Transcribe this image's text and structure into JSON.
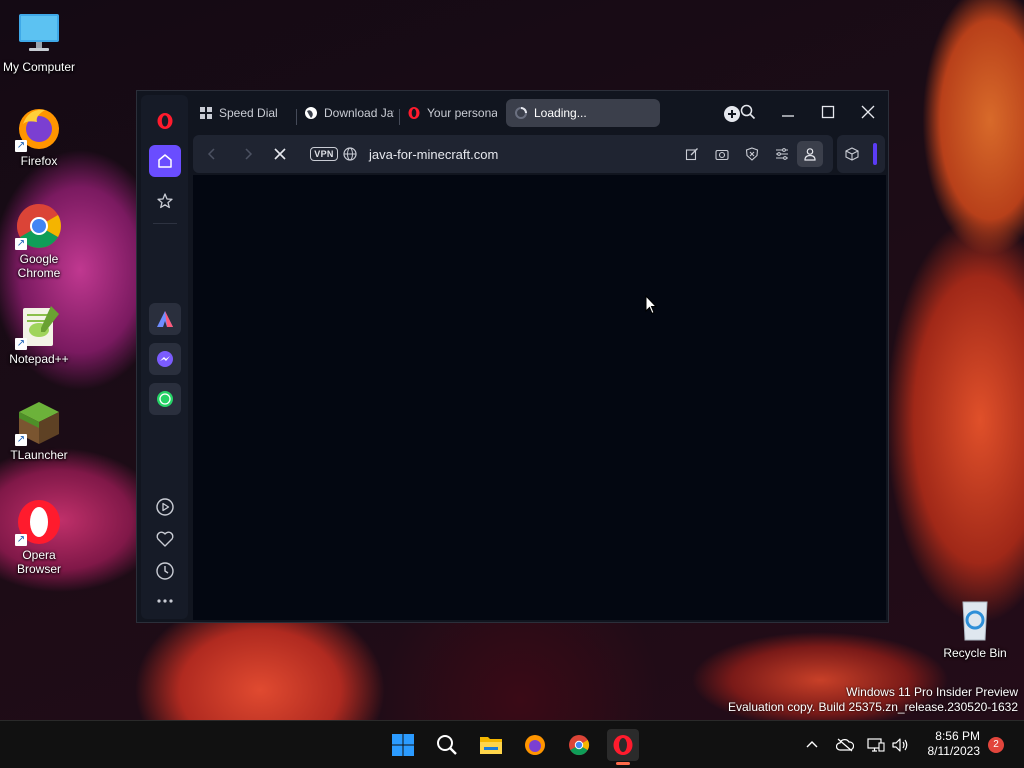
{
  "desktop": {
    "icons": [
      {
        "label": "My Computer"
      },
      {
        "label": "Firefox"
      },
      {
        "label": "Google Chrome"
      },
      {
        "label": "Notepad++"
      },
      {
        "label": "TLauncher"
      },
      {
        "label": "Opera Browser"
      },
      {
        "label": "Recycle Bin"
      }
    ],
    "watermark_line1": "Windows 11 Pro Insider Preview",
    "watermark_line2": "Evaluation copy. Build 25375.zn_release.230520-1632"
  },
  "browser": {
    "tabs": [
      {
        "label": "Speed Dial",
        "icon": "speed-dial-icon"
      },
      {
        "label": "Download Jav",
        "icon": "globe-icon"
      },
      {
        "label": "Your personal",
        "icon": "opera-icon"
      },
      {
        "label": "Loading...",
        "icon": "spinner-icon",
        "active": true
      }
    ],
    "address": {
      "vpn_label": "VPN",
      "url": "java-for-minecraft.com"
    },
    "sidebar": {
      "items": [
        "opera-menu",
        "home",
        "bookmarks",
        "aria",
        "messenger",
        "whatsapp",
        "player",
        "favorites",
        "history",
        "more"
      ]
    }
  },
  "taskbar": {
    "apps": [
      "start",
      "search",
      "file-explorer",
      "firefox",
      "chrome",
      "opera"
    ],
    "time": "8:56 PM",
    "date": "8/11/2023",
    "notification_count": "2"
  },
  "colors": {
    "accent": "#7c5cff",
    "opera_red": "#ff1b2d",
    "window_bg": "#11151f"
  }
}
